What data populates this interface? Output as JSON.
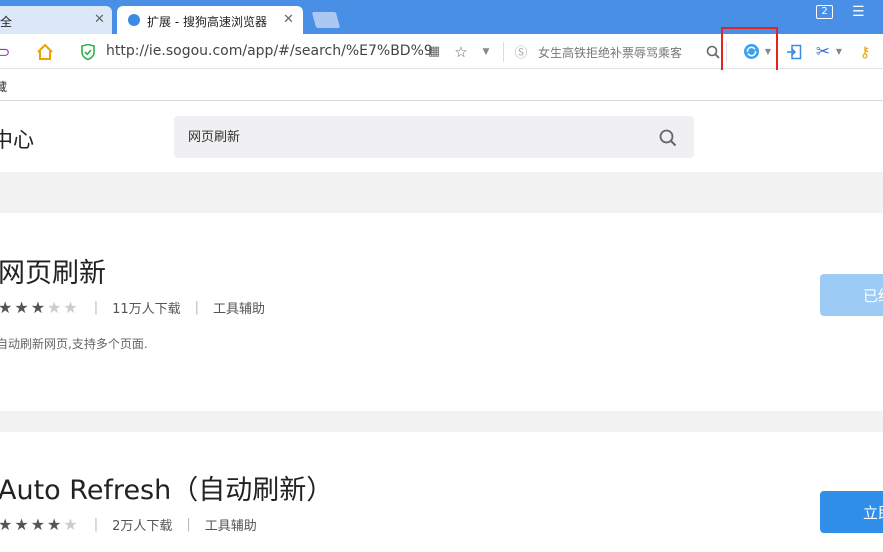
{
  "tabs": [
    {
      "label": "全",
      "active": false
    },
    {
      "label": "扩展 - 搜狗高速浏览器",
      "active": true
    }
  ],
  "window": {
    "tab_count": "2",
    "menu_icon": "menu-icon"
  },
  "toolbar": {
    "url": "http://ie.sogou.com/app/#/search/%E7%BD%9",
    "search_hint": "女生高铁拒绝补票辱骂乘客",
    "highlight_color": "#e0261f"
  },
  "bookmarks": {
    "label": "藏"
  },
  "page": {
    "title": "中心",
    "search_value": "网页刷新"
  },
  "results": [
    {
      "name": "网页刷新",
      "rating": 3,
      "downloads": "11万人下载",
      "category": "工具辅助",
      "description": "自动刷新网页,支持多个页面.",
      "button": "已经添加",
      "button_state": "installed"
    },
    {
      "name": "Auto Refresh（自动刷新）",
      "rating": 4,
      "downloads": "2万人下载",
      "category": "工具辅助",
      "button": "立即安装",
      "button_state": "install"
    }
  ],
  "colors": {
    "tabbar": "#4a8fe6",
    "accent": "#2f8ee8",
    "installed": "#9ccbf6"
  }
}
